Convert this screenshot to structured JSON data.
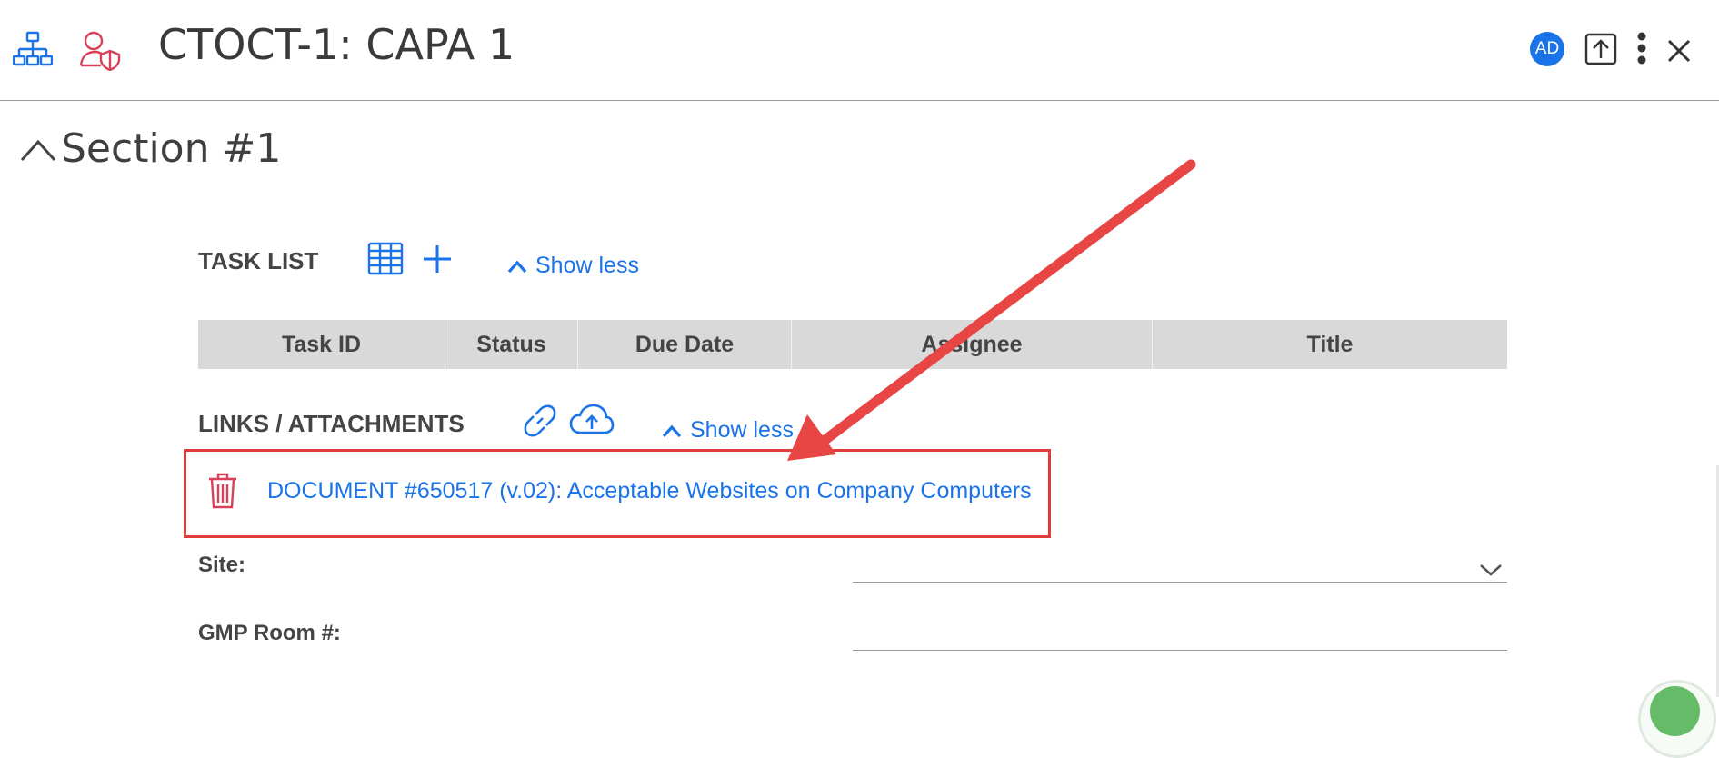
{
  "header": {
    "title": "CTOCT-1: CAPA 1",
    "avatar_initials": "AD",
    "icons": [
      "hierarchy-icon",
      "user-shield-icon",
      "upload-icon",
      "more-vertical-icon",
      "close-icon"
    ]
  },
  "section": {
    "title": "Section #1"
  },
  "task_list": {
    "label": "TASK LIST",
    "show_less": "Show less",
    "columns": [
      "Task ID",
      "Status",
      "Due Date",
      "Assignee",
      "Title"
    ]
  },
  "links": {
    "label": "LINKS / ATTACHMENTS",
    "show_less": "Show less",
    "items": [
      {
        "text": "DOCUMENT #650517 (v.02): Acceptable Websites on Company Computers"
      }
    ]
  },
  "fields": {
    "site_label": "Site:",
    "site_value": "",
    "gmp_label": "GMP Room #:",
    "gmp_value": ""
  },
  "colors": {
    "accent": "#1a73e8",
    "danger": "#d9405a",
    "annotation_red": "#e23b3b",
    "table_header_bg": "#d9d9d9"
  }
}
